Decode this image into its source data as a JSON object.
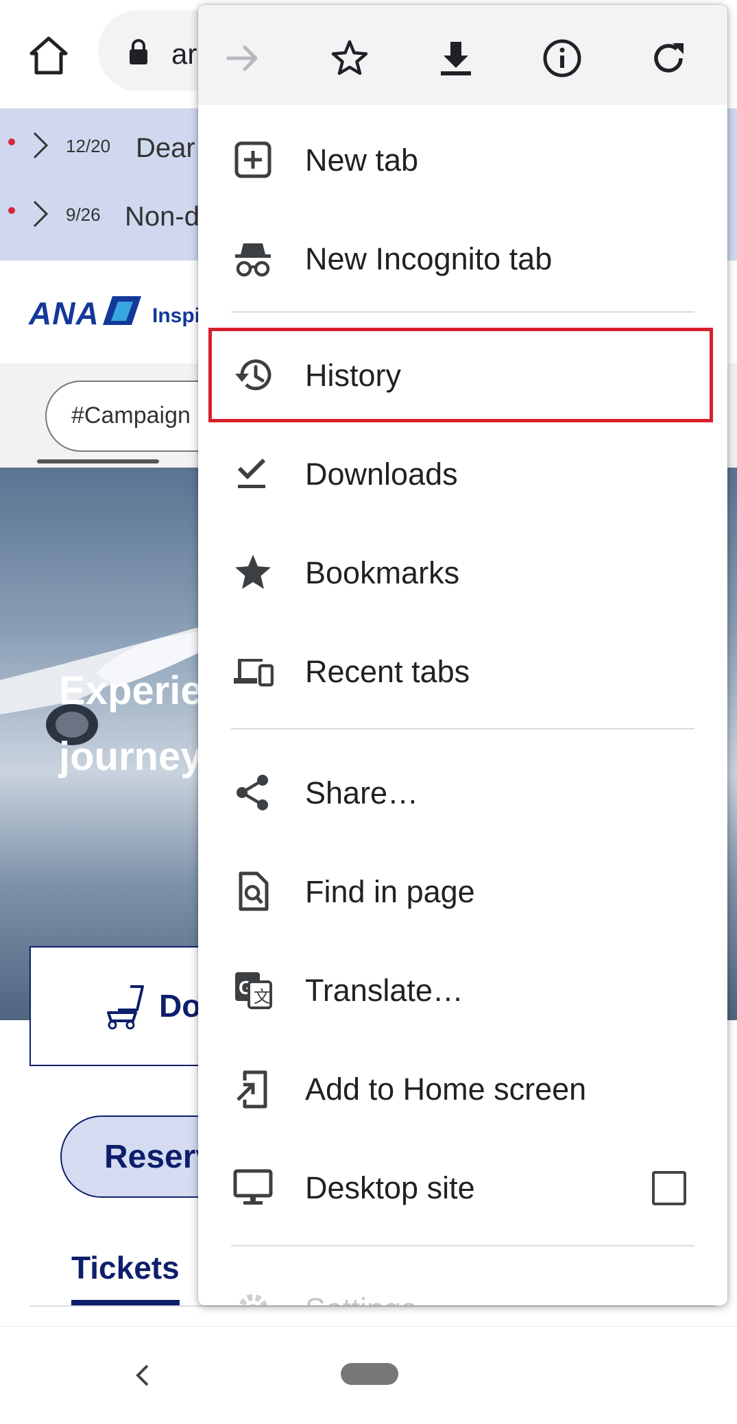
{
  "browser": {
    "url_fragment": "ar"
  },
  "page": {
    "notices": [
      {
        "date": "12/20",
        "text": "Dear"
      },
      {
        "date": "9/26",
        "text": "Non-d"
      }
    ],
    "brand": {
      "logo_text": "ANA",
      "tagline_fragment": "Inspi"
    },
    "chip_label": "#Campaign",
    "hero_title_lines": [
      "Experie",
      "journey"
    ],
    "booking": {
      "tab_label": "Do",
      "reserve_label": "Reserv",
      "tickets_label": "Tickets"
    }
  },
  "menu": {
    "top_icons": [
      "forward-icon",
      "star-icon",
      "download-icon",
      "info-icon",
      "refresh-icon"
    ],
    "items": [
      {
        "label": "New tab",
        "icon": "new-tab-icon"
      },
      {
        "label": "New Incognito tab",
        "icon": "incognito-icon"
      },
      {
        "label": "History",
        "icon": "history-icon",
        "highlighted": true
      },
      {
        "label": "Downloads",
        "icon": "downloads-icon"
      },
      {
        "label": "Bookmarks",
        "icon": "bookmarks-star-icon"
      },
      {
        "label": "Recent tabs",
        "icon": "devices-icon"
      },
      {
        "label": "Share…",
        "icon": "share-icon"
      },
      {
        "label": "Find in page",
        "icon": "find-in-page-icon"
      },
      {
        "label": "Translate…",
        "icon": "translate-icon"
      },
      {
        "label": "Add to Home screen",
        "icon": "add-to-home-icon"
      },
      {
        "label": "Desktop site",
        "icon": "desktop-icon",
        "checkbox_checked": false
      },
      {
        "label": "Settings",
        "icon": "settings-gear-icon"
      }
    ],
    "highlight_color": "#d6202a"
  }
}
